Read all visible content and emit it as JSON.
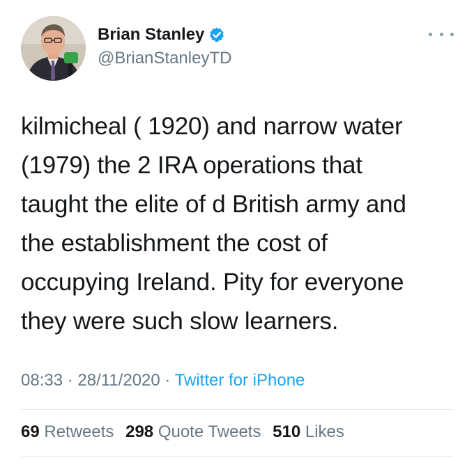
{
  "author": {
    "display_name": "Brian Stanley",
    "handle": "@BrianStanleyTD",
    "verified": true,
    "avatar_icon": "profile-photo"
  },
  "tweet": {
    "text": "kilmicheal ( 1920)  and narrow water\n(1979) the 2 IRA operations that\ntaught the elite of d British army and\nthe establishment the cost of\noccupying Ireland. Pity for everyone\nthey were such slow learners.",
    "time": "08:33",
    "date": "28/11/2020",
    "separator": "·",
    "source": "Twitter for iPhone"
  },
  "stats": {
    "retweets_count": "69",
    "retweets_label": "Retweets",
    "quote_count": "298",
    "quote_label": "Quote Tweets",
    "likes_count": "510",
    "likes_label": "Likes"
  },
  "colors": {
    "text": "#14171a",
    "secondary": "#657786",
    "accent": "#1da1f2",
    "divider": "#e1e8ed"
  }
}
